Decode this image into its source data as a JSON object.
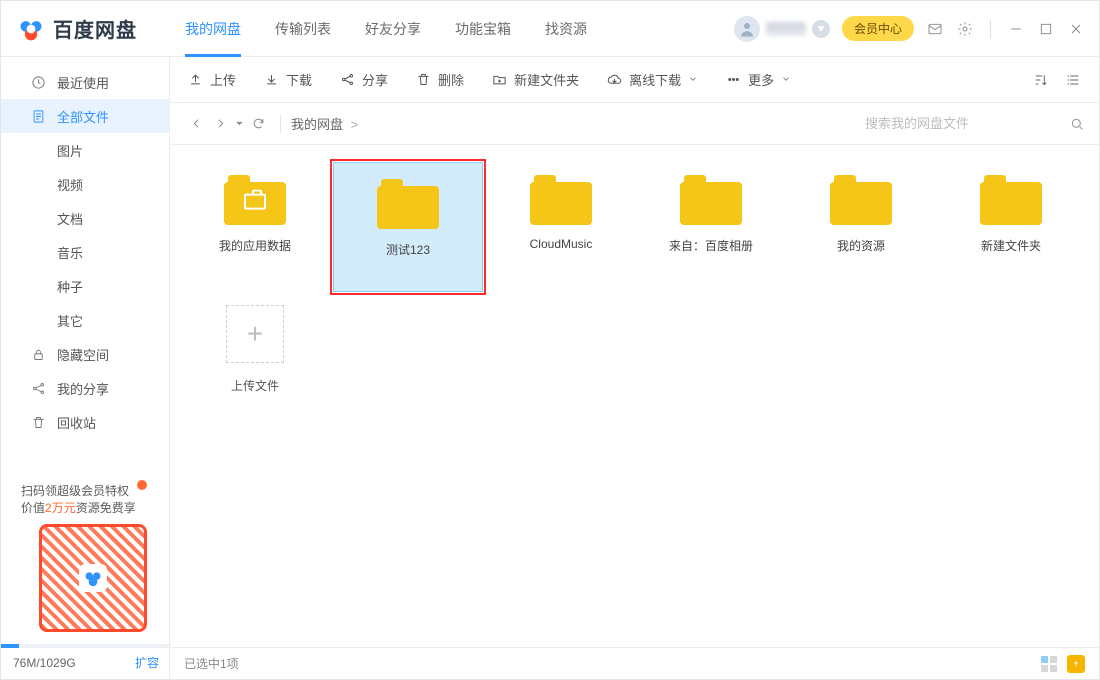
{
  "app": {
    "name": "百度网盘"
  },
  "tabs": [
    "我的网盘",
    "传输列表",
    "好友分享",
    "功能宝箱",
    "找资源"
  ],
  "active_tab_index": 0,
  "titlebar": {
    "vip_label": "会员中心"
  },
  "sidebar": {
    "items": [
      {
        "key": "recent",
        "label": "最近使用",
        "icon": "clock-icon"
      },
      {
        "key": "all",
        "label": "全部文件",
        "icon": "files-icon",
        "active": true
      },
      {
        "key": "pic",
        "label": "图片",
        "sub": true
      },
      {
        "key": "video",
        "label": "视频",
        "sub": true
      },
      {
        "key": "doc",
        "label": "文档",
        "sub": true
      },
      {
        "key": "music",
        "label": "音乐",
        "sub": true
      },
      {
        "key": "seed",
        "label": "种子",
        "sub": true
      },
      {
        "key": "other",
        "label": "其它",
        "sub": true
      },
      {
        "key": "hidden",
        "label": "隐藏空间",
        "icon": "lock-icon"
      },
      {
        "key": "share",
        "label": "我的分享",
        "icon": "share-icon"
      },
      {
        "key": "trash",
        "label": "回收站",
        "icon": "trash-icon"
      }
    ],
    "promo": {
      "line1": "扫码领超级会员特权",
      "line2_a": "价值",
      "line2_b": "2万元",
      "line2_c": "资源免费享"
    },
    "quota": {
      "text": "76M/1029G",
      "expand": "扩容"
    }
  },
  "toolbar": {
    "upload": "上传",
    "download": "下载",
    "share": "分享",
    "delete": "删除",
    "newfolder": "新建文件夹",
    "offline": "离线下载",
    "more": "更多"
  },
  "breadcrumb": {
    "root": "我的网盘",
    "sep": ">"
  },
  "search": {
    "placeholder": "搜索我的网盘文件"
  },
  "folders": [
    {
      "name": "我的应用数据",
      "special": "briefcase"
    },
    {
      "name": "测试123",
      "selected": true,
      "highlight": true
    },
    {
      "name": "CloudMusic"
    },
    {
      "name": "来自：百度相册"
    },
    {
      "name": "我的资源"
    },
    {
      "name": "新建文件夹"
    }
  ],
  "upload_tile": {
    "label": "上传文件"
  },
  "statusbar": {
    "selection": "已选中1项"
  }
}
